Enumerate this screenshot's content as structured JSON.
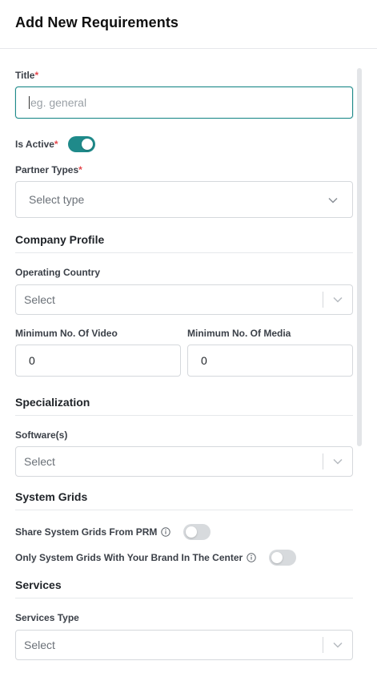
{
  "header": {
    "title": "Add New Requirements"
  },
  "form": {
    "title": {
      "label": "Title",
      "required_mark": "*",
      "placeholder": "eg. general"
    },
    "is_active": {
      "label": "Is Active",
      "required_mark": "*",
      "value": true
    },
    "partner_types": {
      "label": "Partner Types",
      "required_mark": "*",
      "placeholder": "Select type"
    }
  },
  "company_profile": {
    "title": "Company Profile",
    "operating_country": {
      "label": "Operating Country",
      "placeholder": "Select"
    },
    "min_video": {
      "label": "Minimum No. Of Video",
      "value": "0"
    },
    "min_media": {
      "label": "Minimum No. Of Media",
      "value": "0"
    }
  },
  "specialization": {
    "title": "Specialization",
    "software": {
      "label": "Software(s)",
      "placeholder": "Select"
    }
  },
  "system_grids": {
    "title": "System Grids",
    "share_from_prm": {
      "label": "Share System Grids From PRM",
      "value": false
    },
    "brand_in_center": {
      "label": "Only System Grids With Your Brand In The Center",
      "value": false
    }
  },
  "services": {
    "title": "Services",
    "services_type": {
      "label": "Services Type",
      "placeholder": "Select"
    }
  },
  "colors": {
    "accent": "#1f8a8a",
    "required": "#e5484d"
  }
}
